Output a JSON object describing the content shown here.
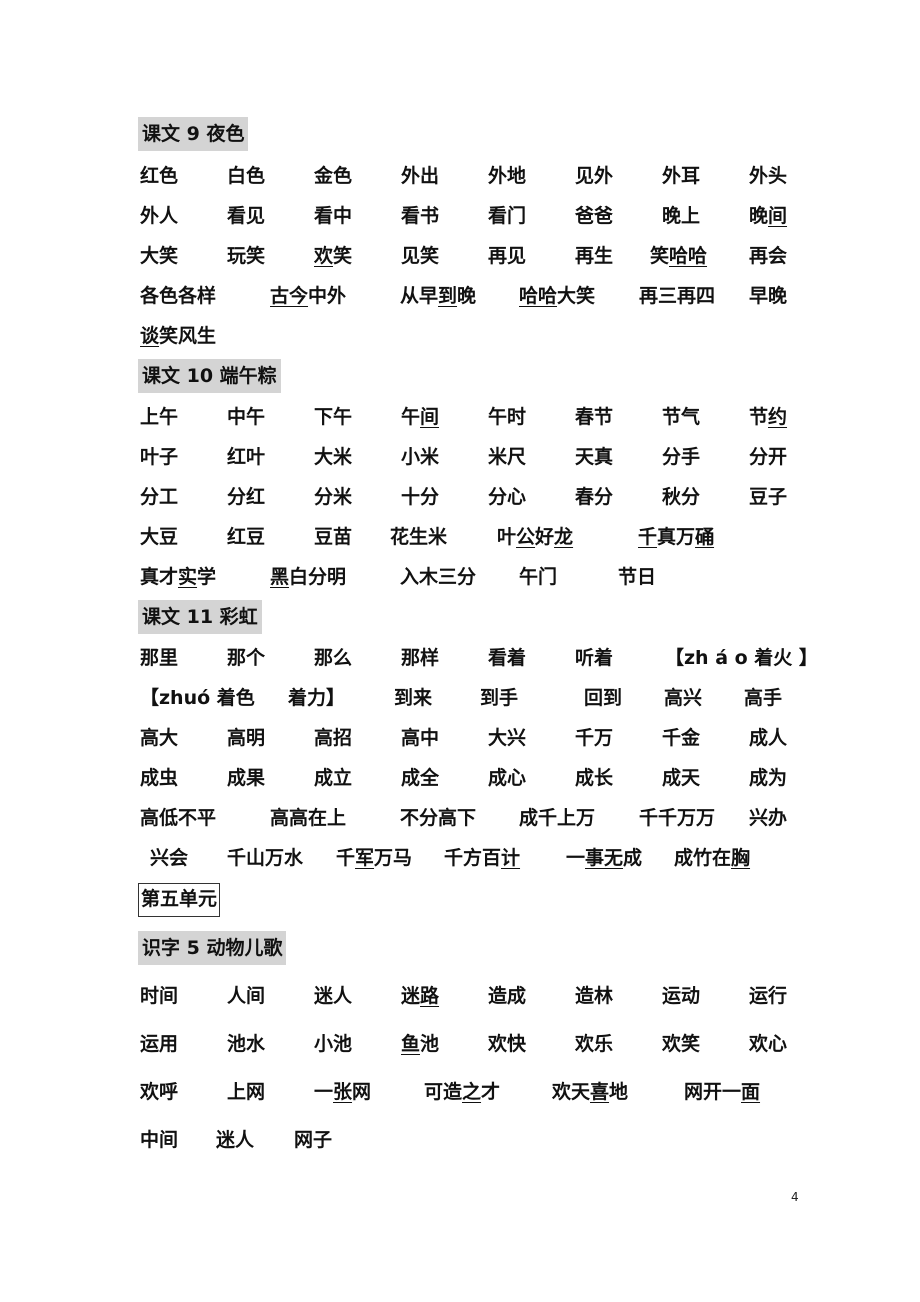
{
  "sections": [
    {
      "title": "课文 9  夜色",
      "rows": [
        [
          {
            "t": "红色"
          },
          {
            "t": "白色"
          },
          {
            "t": "金色"
          },
          {
            "t": "外出"
          },
          {
            "t": "外地"
          },
          {
            "t": "见外"
          },
          {
            "t": "外耳"
          },
          {
            "t": "外头"
          }
        ],
        [
          {
            "t": "外人"
          },
          {
            "t": "看见"
          },
          {
            "t": "看中"
          },
          {
            "t": "看书"
          },
          {
            "t": "看门"
          },
          {
            "t": "爸爸"
          },
          {
            "t": "晚上"
          },
          {
            "t": "晚",
            "u": "间"
          }
        ],
        [
          {
            "t": "大笑"
          },
          {
            "t": "玩笑"
          },
          {
            "u": "欢",
            "t": "笑"
          },
          {
            "t": "见笑"
          },
          {
            "t": "再见"
          },
          {
            "t": "再生"
          },
          {
            "t": "笑",
            "u": "哈哈"
          },
          {
            "t": "再会"
          }
        ],
        [
          {
            "t": "各色各样"
          },
          {
            "u": "古今",
            "t": "中外"
          },
          {
            "t": "从早",
            "u": "到",
            "t2": "晚"
          },
          {
            "u": "哈哈",
            "t": "大笑"
          },
          {
            "t": "再三再四"
          },
          {
            "t": "早晚"
          }
        ],
        [
          {
            "u": "谈",
            "t": "笑风生"
          }
        ]
      ]
    },
    {
      "title": "课文 10  端午粽",
      "rows": [
        [
          {
            "t": "上午"
          },
          {
            "t": "中午"
          },
          {
            "t": "下午"
          },
          {
            "t": "午",
            "u": "间"
          },
          {
            "t": "午时"
          },
          {
            "t": "春节"
          },
          {
            "t": "节气"
          },
          {
            "t": "节",
            "u": "约"
          }
        ],
        [
          {
            "t": "叶子"
          },
          {
            "t": "红叶"
          },
          {
            "t": "大米"
          },
          {
            "t": "小米"
          },
          {
            "t": "米尺"
          },
          {
            "t": "天真"
          },
          {
            "t": "分手"
          },
          {
            "t": "分开"
          }
        ],
        [
          {
            "t": "分工"
          },
          {
            "t": "分红"
          },
          {
            "t": "分米"
          },
          {
            "t": "十分"
          },
          {
            "t": "分心"
          },
          {
            "t": "春分"
          },
          {
            "t": "秋分"
          },
          {
            "t": "豆子"
          }
        ],
        [
          {
            "t": "大豆"
          },
          {
            "t": "红豆"
          },
          {
            "t": "豆苗"
          },
          {
            "t": "花生米"
          },
          {
            "t": "叶",
            "u": "公",
            "t2": "好",
            "u2": "龙 "
          },
          {
            "u": "千",
            "t": "真万",
            "u2": "硧"
          }
        ],
        [
          {
            "t": "真才",
            "u": "实",
            "t2": "学"
          },
          {
            "u": "黑",
            "t": "白分明"
          },
          {
            "t": "入木三分"
          },
          {
            "t": "午门"
          },
          {
            "t": "节日"
          }
        ]
      ]
    },
    {
      "title": "课文 11  彩虹",
      "rows": [
        [
          {
            "t": "那里"
          },
          {
            "t": "那个"
          },
          {
            "t": "那么"
          },
          {
            "t": "那样"
          },
          {
            "t": "看着"
          },
          {
            "t": "听着"
          },
          {
            "t": "【zh á o 着火  】"
          }
        ],
        [
          {
            "t": "【zhuó 着色"
          },
          {
            "t": "着力】"
          },
          {
            "t": "到来"
          },
          {
            "t": "到手"
          },
          {
            "t": "回到"
          },
          {
            "t": "高兴"
          },
          {
            "t": "高手"
          }
        ],
        [
          {
            "t": "高大"
          },
          {
            "t": "高明"
          },
          {
            "t": "高招"
          },
          {
            "t": "高中"
          },
          {
            "t": "大兴"
          },
          {
            "t": "千万"
          },
          {
            "t": "千金"
          },
          {
            "t": "成人"
          }
        ],
        [
          {
            "t": "成虫"
          },
          {
            "t": "成果"
          },
          {
            "t": "成立"
          },
          {
            "t": "成全"
          },
          {
            "t": "成心"
          },
          {
            "t": "成长"
          },
          {
            "t": "成天"
          },
          {
            "t": "成为"
          }
        ],
        [
          {
            "t": "高低不平"
          },
          {
            "t": "高高在上"
          },
          {
            "t": "不分高下"
          },
          {
            "t": "成千上万"
          },
          {
            "t": "千千万万"
          },
          {
            "t": "兴办"
          }
        ],
        [
          {
            "t": "兴会"
          },
          {
            "t": "千山万水"
          },
          {
            "t": "千",
            "u": "军",
            "t2": "万马"
          },
          {
            "t": "千方百",
            "u": "计"
          },
          {
            "t": "一",
            "u": "事无",
            "t2": "成"
          },
          {
            "t": "成竹在",
            "u": "胸"
          }
        ]
      ]
    },
    {
      "unit_label": "第五单元",
      "title": "识字 5  动物儿歌",
      "rows": [
        [
          {
            "t": "时间"
          },
          {
            "t": "人间"
          },
          {
            "t": "迷人"
          },
          {
            "t": "迷",
            "u": "路"
          },
          {
            "t": "造成"
          },
          {
            "t": "造林"
          },
          {
            "t": "运动"
          },
          {
            "t": "运行"
          }
        ],
        [
          {
            "t": "运用"
          },
          {
            "t": "池水"
          },
          {
            "t": "小池"
          },
          {
            "u": "鱼",
            "t": "池"
          },
          {
            "t": "欢快"
          },
          {
            "t": "欢乐"
          },
          {
            "t": "欢笑"
          },
          {
            "t": "欢心"
          }
        ],
        [
          {
            "t": "欢呼"
          },
          {
            "t": "上网"
          },
          {
            "t": "一",
            "u": "张",
            "t2": "网"
          },
          {
            "t": "可造",
            "u": "之",
            "t2": "才"
          },
          {
            "t": "欢天",
            "u": "喜",
            "t2": "地"
          },
          {
            "t": "网开一",
            "u": "面"
          }
        ],
        [
          {
            "t": "中间"
          },
          {
            "t": "迷人"
          },
          {
            "t": "网子"
          }
        ]
      ]
    }
  ],
  "page_number": "4"
}
